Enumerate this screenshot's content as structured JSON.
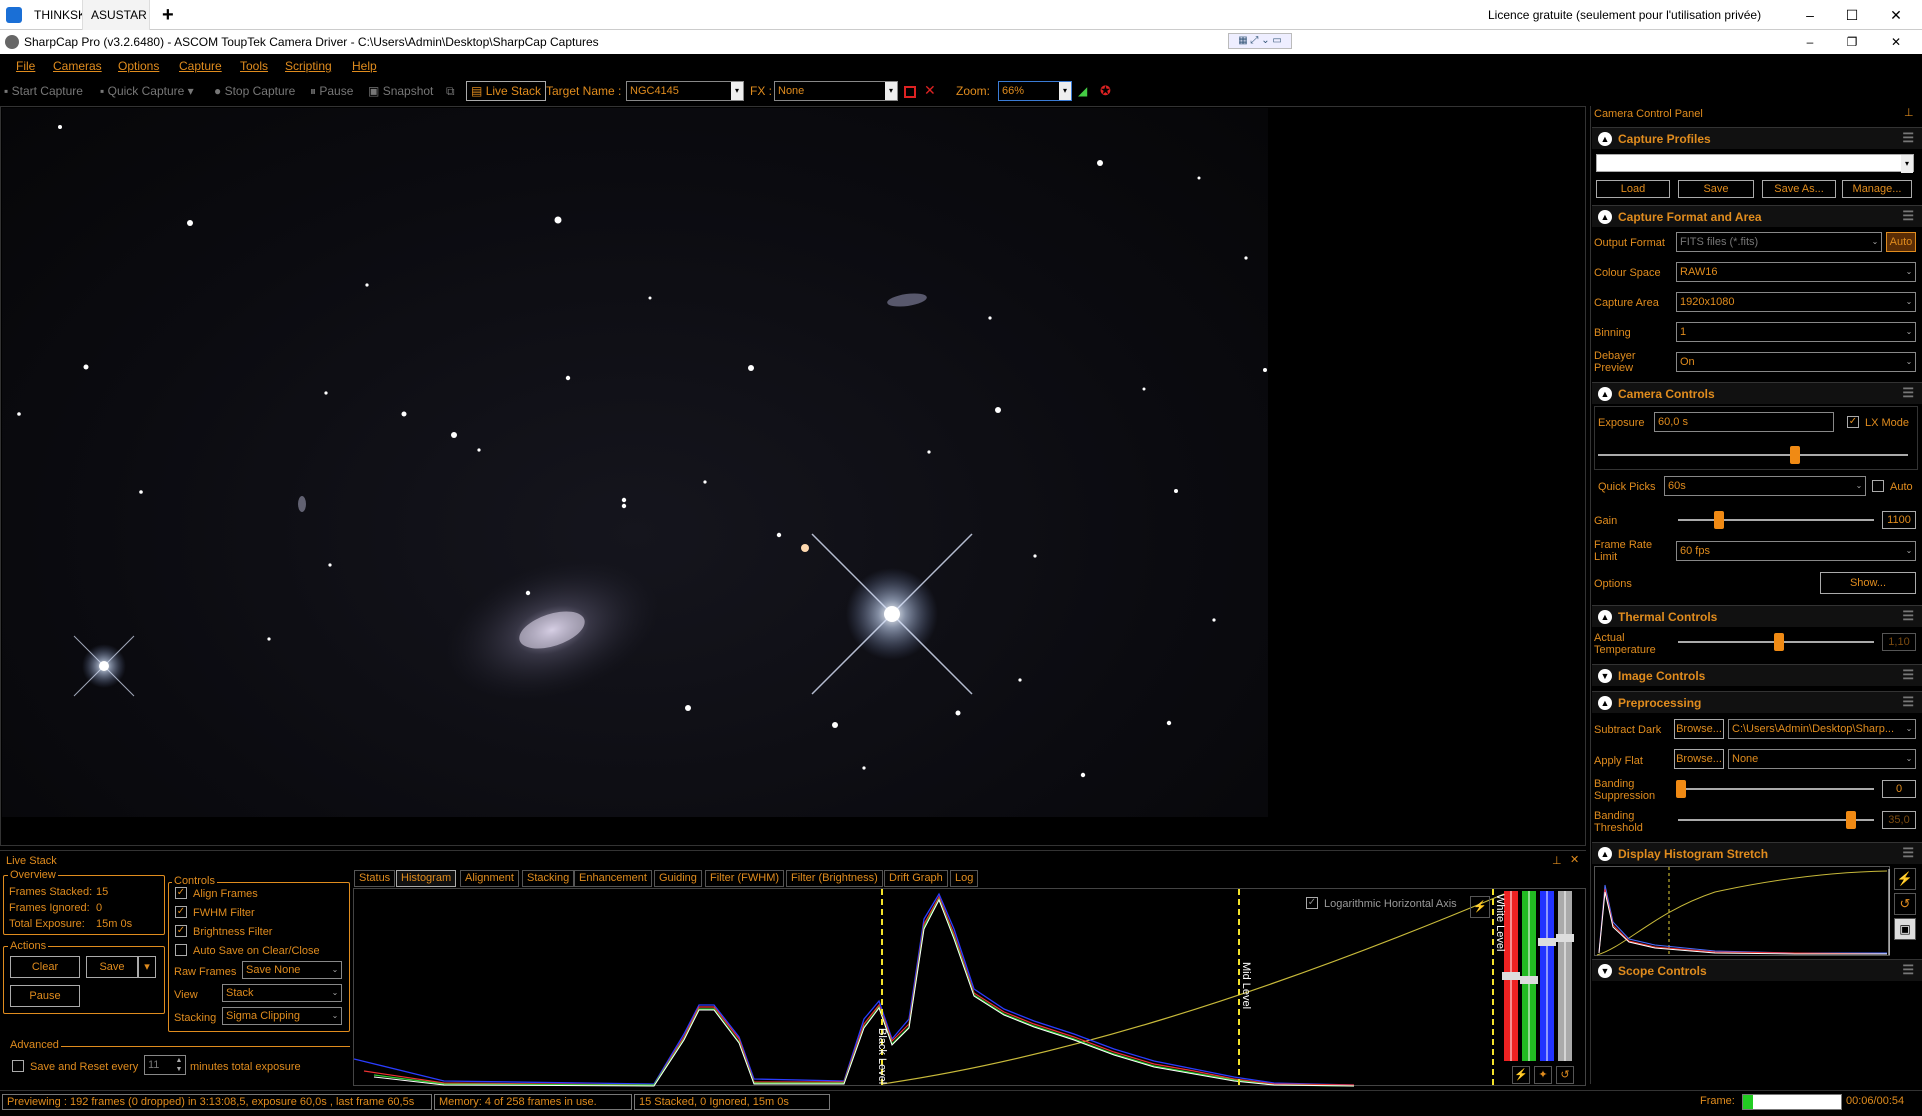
{
  "remote": {
    "tab1": "THINKSKY",
    "tab2": "ASUSTAR",
    "tab_close": "✕",
    "new_tab": "+",
    "license": "Licence gratuite (seulement pour l'utilisation privée)"
  },
  "window": {
    "title": "SharpCap Pro (v3.2.6480) - ASCOM ToupTek Camera Driver - C:\\Users\\Admin\\Desktop\\SharpCap Captures"
  },
  "menu": [
    "File",
    "Cameras",
    "Options",
    "Capture",
    "Tools",
    "Scripting",
    "Help"
  ],
  "toolbar": {
    "start_capture": "Start Capture",
    "quick_capture": "Quick Capture",
    "stop_capture": "Stop Capture",
    "pause": "Pause",
    "snapshot": "Snapshot",
    "live_stack": "Live Stack",
    "target_label": "Target Name :",
    "target_value": "NGC4145",
    "fx_label": "FX :",
    "fx_value": "None",
    "zoom_label": "Zoom:",
    "zoom_value": "66%"
  },
  "ccp": {
    "title": "Camera Control Panel",
    "capture_profiles": "Capture Profiles",
    "load": "Load",
    "save": "Save",
    "save_as": "Save As...",
    "manage": "Manage...",
    "capture_format": "Capture Format and Area",
    "output_format_label": "Output Format",
    "output_format_value": "FITS files (*.fits)",
    "auto_btn": "Auto",
    "colour_space_label": "Colour Space",
    "colour_space_value": "RAW16",
    "capture_area_label": "Capture Area",
    "capture_area_value": "1920x1080",
    "binning_label": "Binning",
    "binning_value": "1",
    "debayer_label1": "Debayer",
    "debayer_label2": "Preview",
    "debayer_value": "On",
    "camera_controls": "Camera Controls",
    "exposure_label": "Exposure",
    "exposure_value": "60,0 s",
    "lx_mode": "LX Mode",
    "quick_picks_label": "Quick Picks",
    "quick_picks_value": "60s",
    "auto_label": "Auto",
    "gain_label": "Gain",
    "gain_value": "1100",
    "frame_rate_label1": "Frame Rate",
    "frame_rate_label2": "Limit",
    "frame_rate_value": "60 fps",
    "options_label": "Options",
    "show_btn": "Show...",
    "thermal_controls": "Thermal Controls",
    "actual_temp_label1": "Actual",
    "actual_temp_label2": "Temperature",
    "actual_temp_value": "1,10",
    "image_controls": "Image Controls",
    "preprocessing": "Preprocessing",
    "subtract_dark_label": "Subtract Dark",
    "browse": "Browse...",
    "subtract_dark_value": "C:\\Users\\Admin\\Desktop\\Sharp...",
    "apply_flat_label": "Apply Flat",
    "apply_flat_value": "None",
    "banding_supp_label1": "Banding",
    "banding_supp_label2": "Suppression",
    "banding_supp_value": "0",
    "banding_thr_label1": "Banding",
    "banding_thr_label2": "Threshold",
    "banding_thr_value": "35,0",
    "display_hist": "Display Histogram Stretch",
    "scope_controls": "Scope Controls"
  },
  "livestack": {
    "title": "Live Stack",
    "overview": "Overview",
    "frames_stacked_label": "Frames Stacked:",
    "frames_stacked_value": "15",
    "frames_ignored_label": "Frames Ignored:",
    "frames_ignored_value": "0",
    "total_exposure_label": "Total Exposure:",
    "total_exposure_value": "15m 0s",
    "actions": "Actions",
    "clear": "Clear",
    "save": "Save",
    "pause": "Pause",
    "controls": "Controls",
    "align_frames": "Align Frames",
    "fwhm_filter": "FWHM Filter",
    "brightness_filter": "Brightness Filter",
    "auto_save": "Auto Save on Clear/Close",
    "raw_frames_label": "Raw Frames",
    "raw_frames_value": "Save None",
    "view_label": "View",
    "view_value": "Stack",
    "stacking_label": "Stacking",
    "stacking_value": "Sigma Clipping",
    "advanced": "Advanced",
    "save_reset": "Save and Reset every",
    "minutes_value": "11",
    "minutes_label": "minutes total exposure",
    "tabs": [
      "Status",
      "Histogram",
      "Alignment",
      "Stacking",
      "Enhancement",
      "Guiding",
      "Filter (FWHM)",
      "Filter (Brightness)",
      "Drift Graph",
      "Log"
    ],
    "log_axis": "Logarithmic Horizontal Axis",
    "black_level": "Black Level",
    "mid_level": "Mid Level",
    "white_level": "White Level"
  },
  "status": {
    "previewing": "Previewing : 192 frames (0 dropped) in 3:13:08,5, exposure 60,0s , last frame 60,5s",
    "memory": "Memory: 4 of 258 frames in use.",
    "stacked": "15 Stacked, 0 Ignored, 15m 0s",
    "frame_label": "Frame:",
    "time": "00:06/00:54"
  }
}
